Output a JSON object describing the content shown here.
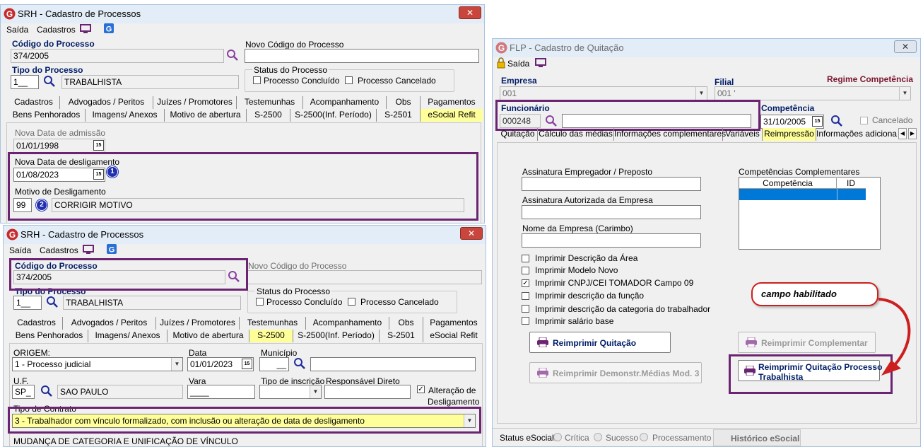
{
  "colors": {
    "highlight": "#6b2471",
    "accent_navy": "#001c66",
    "selected_tab": "#ffff99",
    "callout_red": "#cc1f1f"
  },
  "win1": {
    "title": "SRH - Cadastro de Processos",
    "close": "✕",
    "menu": [
      "Saída",
      "Cadastros"
    ],
    "codigo_label": "Código do Processo",
    "codigo_value": "374/2005",
    "novo_codigo_label": "Novo Código do Processo",
    "novo_codigo_value": "",
    "tipo_label": "Tipo do Processo",
    "tipo_code": "1__",
    "tipo_desc": "TRABALHISTA",
    "status_label": "Status do Processo",
    "status_concluido": "Processo Concluído",
    "status_cancelado": "Processo Cancelado",
    "tabs_row1": [
      "Cadastros",
      "Advogados / Peritos",
      "Juízes / Promotores",
      "Testemunhas",
      "Acompanhamento",
      "Obs",
      "Pagamentos"
    ],
    "tabs_row2": [
      "Bens Penhorados",
      "Imagens/ Anexos",
      "Motivo de abertura",
      "S-2500",
      "S-2500(Inf. Período)",
      "S-2501",
      "eSocial Refit"
    ],
    "nova_admissao_label": "Nova Data de admissão",
    "nova_admissao_value": "01/01/1998",
    "nova_deslig_label": "Nova Data de desligamento",
    "nova_deslig_value": "01/08/2023",
    "motivo_label": "Motivo de Desligamento",
    "motivo_code": "99",
    "motivo_desc": "CORRIGIR MOTIVO",
    "badge1": "1",
    "badge2": "2"
  },
  "win2": {
    "title": "SRH - Cadastro de Processos",
    "close": "✕",
    "menu": [
      "Saída",
      "Cadastros"
    ],
    "codigo_label": "Código do Processo",
    "codigo_value": "374/2005",
    "novo_codigo_label": "Novo Código do Processo",
    "tipo_label": "Tipo do Processo",
    "tipo_code": "1__",
    "tipo_desc": "TRABALHISTA",
    "status_label": "Status do Processo",
    "status_concluido": "Processo Concluído",
    "status_cancelado": "Processo Cancelado",
    "tabs_row1": [
      "Cadastros",
      "Advogados / Peritos",
      "Juízes / Promotores",
      "Testemunhas",
      "Acompanhamento",
      "Obs",
      "Pagamentos"
    ],
    "tabs_row2": [
      "Bens Penhorados",
      "Imagens/ Anexos",
      "Motivo de abertura",
      "S-2500",
      "S-2500(Inf. Período)",
      "S-2501",
      "eSocial Refit"
    ],
    "origem_label": "ORIGEM:",
    "origem_value": "1 - Processo judicial",
    "data_label": "Data",
    "data_value": "01/01/2023",
    "municipio_label": "Município",
    "municipio_code": "__",
    "uf_label": "U.F.",
    "uf_code": "SP_",
    "uf_desc": "SAO PAULO",
    "vara_label": "Vara",
    "vara_value": "____",
    "tipo_inscricao_label": "Tipo de inscrição",
    "responsavel_label": "Responsável Direto",
    "alteracao_label_1": "Alteração de",
    "alteracao_label_2": "Desligamento",
    "tipo_contrato_label": "Tipo de Contrato",
    "tipo_contrato_value": "3 - Trabalhador com vínculo formalizado, com inclusão ou alteração de data de desligamento",
    "mudanca_label": "MUDANÇA DE CATEGORIA E UNIFICAÇÃO DE VÍNCULO"
  },
  "win3": {
    "title": "FLP - Cadastro de Quitação",
    "close": "✕",
    "menu": [
      "Saída"
    ],
    "empresa_label": "Empresa",
    "empresa_value": "001",
    "filial_label": "Filial",
    "filial_value": "001 '",
    "regime_label": "Regime Competência",
    "funcionario_label": "Funcionário",
    "funcionario_code": "000248",
    "competencia_label": "Competência",
    "competencia_value": "31/10/2005",
    "cancelado_label": "Cancelado",
    "tabs": [
      "Quitação",
      "Cálculo das médias",
      "Informações complementares",
      "Variáveis",
      "Reimpressão",
      "Informações adicionais"
    ],
    "assin_empregador_label": "Assinatura Empregador / Preposto",
    "assin_autorizada_label": "Assinatura Autorizada da Empresa",
    "nome_empresa_label": "Nome da Empresa (Carimbo)",
    "checks": [
      {
        "label": "Imprimir Descrição da Área",
        "checked": ""
      },
      {
        "label": "Imprimir Modelo Novo",
        "checked": ""
      },
      {
        "label": "Imprimir CNPJ/CEI TOMADOR Campo 09",
        "checked": "✓"
      },
      {
        "label": "Imprimir descrição da função",
        "checked": ""
      },
      {
        "label": "Imprimir descrição da categoria do trabalhador",
        "checked": ""
      },
      {
        "label": "Imprimir salário base",
        "checked": ""
      }
    ],
    "comp_complementares_label": "Competências Complementares",
    "comp_col1": "Competência",
    "comp_col2": "ID",
    "btn_reimp_quitacao": "Reimprimir Quitação",
    "btn_reimp_complementar": "Reimprimir Complementar",
    "btn_reimp_demonstr": "Reimprimir Demonstr.Médias Mod. 3",
    "btn_reimp_processo": "Reimprimir Quitação Processo Trabalhista",
    "callout": "campo habilitado",
    "status_label": "Status eSocial:",
    "status_critica": "Crítica",
    "status_sucesso": "Sucesso",
    "status_processamento": "Processamento",
    "historico": "Histórico eSocial"
  }
}
